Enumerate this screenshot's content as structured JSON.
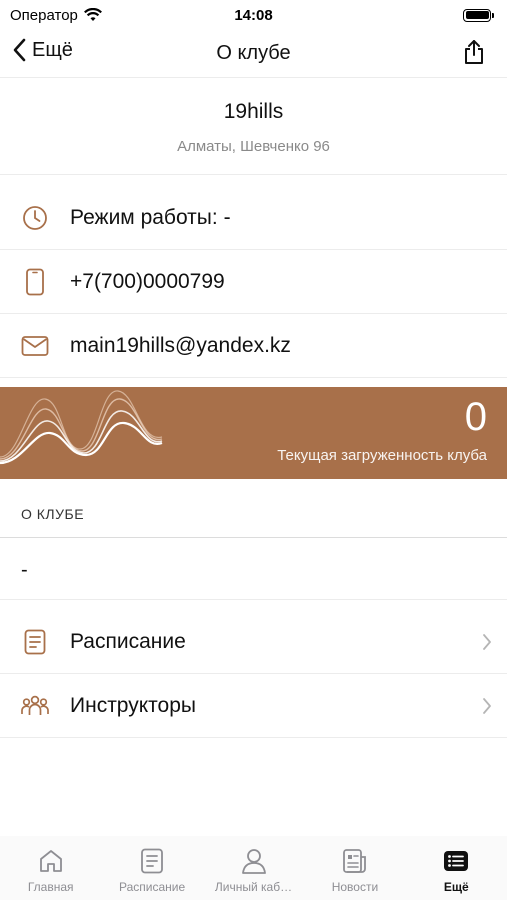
{
  "status_bar": {
    "carrier": "Оператор",
    "time": "14:08"
  },
  "nav": {
    "back_label": "Ещё",
    "title": "О клубе"
  },
  "club": {
    "name": "19hills",
    "address": "Алматы, Шевченко 96"
  },
  "info": {
    "hours": "Режим работы: -",
    "phone": "+7(700)0000799",
    "email": "main19hills@yandex.kz"
  },
  "load": {
    "value": "0",
    "label": "Текущая загруженность клуба"
  },
  "about": {
    "section_title": "О КЛУБЕ",
    "text": "-"
  },
  "links": [
    {
      "label": "Расписание",
      "icon": "schedule-icon"
    },
    {
      "label": "Инструкторы",
      "icon": "instructors-icon"
    }
  ],
  "tabs": [
    {
      "label": "Главная",
      "icon": "home-icon",
      "active": false
    },
    {
      "label": "Расписание",
      "icon": "schedule-icon",
      "active": false
    },
    {
      "label": "Личный каб…",
      "icon": "person-icon",
      "active": false
    },
    {
      "label": "Новости",
      "icon": "news-icon",
      "active": false
    },
    {
      "label": "Ещё",
      "icon": "more-list-icon",
      "active": true
    }
  ],
  "colors": {
    "accent": "#a8704a",
    "icon_brown": "#a8704a"
  }
}
